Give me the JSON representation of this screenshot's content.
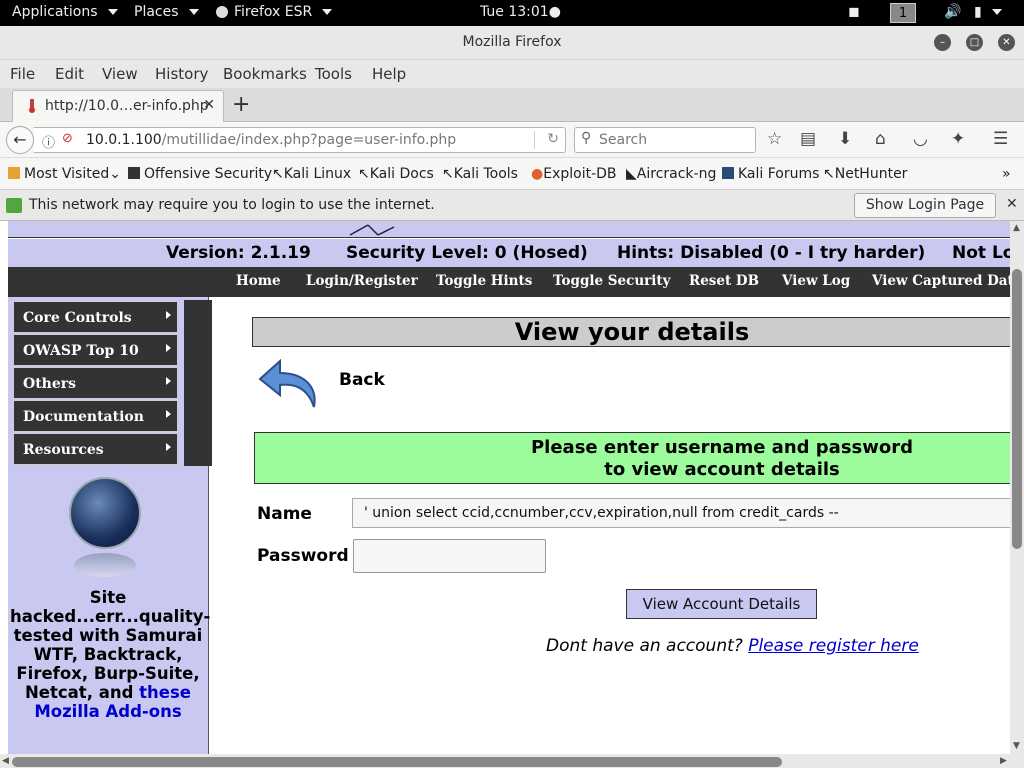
{
  "topbar": {
    "applications": "Applications",
    "places": "Places",
    "firefox": "Firefox ESR",
    "clock": "Tue 13:01●",
    "workspace": "1"
  },
  "window": {
    "title": "Mozilla Firefox"
  },
  "menubar": [
    "File",
    "Edit",
    "View",
    "History",
    "Bookmarks",
    "Tools",
    "Help"
  ],
  "tab": {
    "title": "http://10.0…er-info.php"
  },
  "navbar": {
    "url_host": "10.0.1.100",
    "url_path": "/mutillidae/index.php?page=user-info.php",
    "search_placeholder": "Search"
  },
  "bookmarks": [
    "Most Visited",
    "Offensive Security",
    "Kali Linux",
    "Kali Docs",
    "Kali Tools",
    "Exploit-DB",
    "Aircrack-ng",
    "Kali Forums",
    "NetHunter"
  ],
  "notification": {
    "text": "This network may require you to login to use the internet.",
    "button": "Show Login Page"
  },
  "page": {
    "version": "Version: 2.1.19",
    "security": "Security Level: 0 (Hosed)",
    "hints": "Hints: Disabled (0 - I try harder)",
    "login_status": "Not Lo",
    "nav": [
      "Home",
      "Login/Register",
      "Toggle Hints",
      "Toggle Security",
      "Reset DB",
      "View Log",
      "View Captured Data"
    ],
    "side_menu": [
      "Core Controls",
      "OWASP Top 10",
      "Others",
      "Documentation",
      "Resources"
    ],
    "side_text": "Site hacked...err...quality-tested with Samurai WTF, Backtrack, Firefox, Burp-Suite, Netcat, and",
    "side_link": "these Mozilla Add-ons",
    "heading": "View your details",
    "back": "Back",
    "prompt_line1": "Please enter username and password",
    "prompt_line2": "to view account details",
    "name_label": "Name",
    "name_value": "' union select ccid,ccnumber,ccv,expiration,null from credit_cards --",
    "password_label": "Password",
    "submit": "View Account Details",
    "register_text": "Dont have an account?",
    "register_link": "Please register here"
  }
}
